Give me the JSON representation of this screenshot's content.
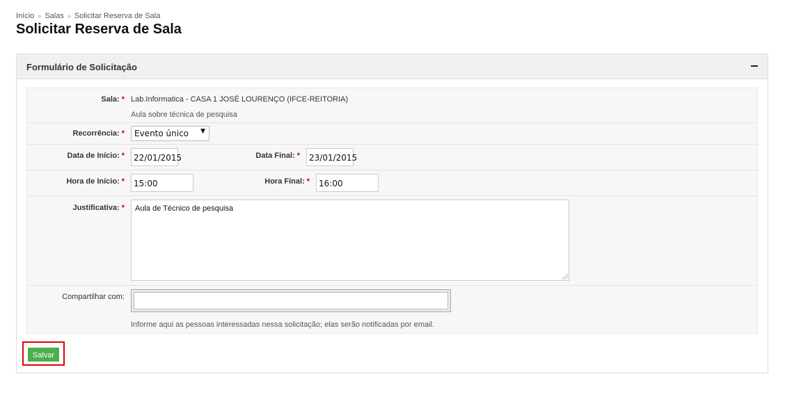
{
  "breadcrumb": {
    "items": [
      "Início",
      "Salas",
      "Solicitar Reserva de Sala"
    ],
    "separator": "»"
  },
  "page": {
    "title": "Solicitar Reserva de Sala"
  },
  "panel": {
    "title": "Formulário de Solicitação",
    "collapse_symbol": "−"
  },
  "form": {
    "required_marker": "*",
    "sala": {
      "label": "Sala:",
      "value": "Lab.Informatica - CASA 1 JOSÉ LOURENÇO (IFCE-REITORIA)",
      "description": "Aula sobre técnica de pesquisa"
    },
    "recorrencia": {
      "label": "Recorrência:",
      "selected": "Evento único",
      "arrow": "▼"
    },
    "data_inicio": {
      "label": "Data de Início:",
      "value": "22/01/2015"
    },
    "data_final": {
      "label": "Data Final:",
      "value": "23/01/2015"
    },
    "hora_inicio": {
      "label": "Hora de Início:",
      "value": "15:00"
    },
    "hora_final": {
      "label": "Hora Final:",
      "value": "16:00"
    },
    "justificativa": {
      "label": "Justificativa:",
      "value": "Aula de Técnico de pesquisa"
    },
    "compartilhar": {
      "label": "Compartilhar com:",
      "value": "",
      "help": "Informe aqui as pessoas interessadas nessa solicitação; elas serão notificadas por email."
    }
  },
  "actions": {
    "save_label": "Salvar",
    "save_color": "#4cae4c",
    "highlight_color": "#e00000"
  }
}
